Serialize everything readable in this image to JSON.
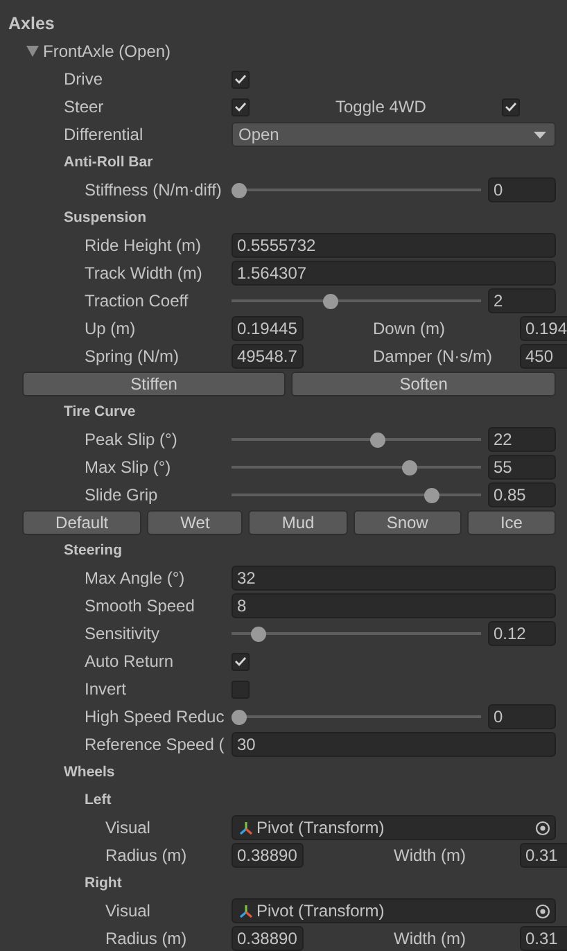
{
  "title": "Axles",
  "axles": [
    {
      "label": "FrontAxle  (Open)",
      "expanded": true,
      "children": [
        {
          "kind": "toggle",
          "label": "Drive",
          "checked": true
        },
        {
          "kind": "toggle-pair",
          "label": "Steer",
          "checked": true,
          "second": {
            "label": "Toggle 4WD",
            "checked": true
          }
        },
        {
          "kind": "dropdown",
          "label": "Differential",
          "value": "Open"
        },
        {
          "kind": "section",
          "label": "Anti-Roll Bar",
          "children": [
            {
              "kind": "slider",
              "label": "Stiffness (N/m·diff)",
              "level": 0,
              "value": "0"
            }
          ]
        },
        {
          "kind": "section",
          "label": "Suspension",
          "children": [
            {
              "kind": "field",
              "label": "Ride Height (m)",
              "value": "0.5555732"
            },
            {
              "kind": "field",
              "label": "Track Width (m)",
              "value": "1.564307"
            },
            {
              "kind": "slider",
              "label": "Traction Coeff",
              "level": 0.39,
              "value": "2"
            },
            {
              "kind": "field-pair",
              "label": "Up (m)",
              "value": "0.19445",
              "second": {
                "label": "Down (m)",
                "value": "0.194"
              }
            },
            {
              "kind": "field-pair",
              "label": "Spring (N/m)",
              "value": "49548.7",
              "second": {
                "label": "Damper (N·s/m)",
                "value": "450"
              }
            },
            {
              "kind": "buttons",
              "buttons": [
                "Stiffen",
                "Soften"
              ]
            }
          ]
        },
        {
          "kind": "section",
          "label": "Tire Curve",
          "children": [
            {
              "kind": "slider",
              "label": "Peak Slip (°)",
              "level": 0.59,
              "value": "22"
            },
            {
              "kind": "slider",
              "label": "Max Slip (°)",
              "level": 0.73,
              "value": "55"
            },
            {
              "kind": "slider",
              "label": "Slide Grip",
              "level": 0.82,
              "value": "0.85"
            },
            {
              "kind": "buttons",
              "buttons": [
                "Default",
                "Wet",
                "Mud",
                "Snow",
                "Ice"
              ]
            }
          ]
        },
        {
          "kind": "section",
          "label": "Steering",
          "children": [
            {
              "kind": "field",
              "label": "Max Angle (°)",
              "value": "32"
            },
            {
              "kind": "field",
              "label": "Smooth Speed",
              "value": "8"
            },
            {
              "kind": "slider",
              "label": "Sensitivity",
              "level": 0.08,
              "value": "0.12"
            },
            {
              "kind": "toggle",
              "label": "Auto Return",
              "checked": true
            },
            {
              "kind": "toggle",
              "label": "Invert",
              "checked": false
            },
            {
              "kind": "slider",
              "label": "High Speed Reduc",
              "level": 0,
              "value": "0"
            },
            {
              "kind": "field",
              "label": "Reference Speed (",
              "value": "30"
            }
          ]
        },
        {
          "kind": "section",
          "label": "Wheels",
          "children": [
            {
              "kind": "section",
              "label": "Left",
              "children": [
                {
                  "kind": "object",
                  "label": "Visual",
                  "value": "Pivot (Transform)"
                },
                {
                  "kind": "field-pair",
                  "label": "Radius (m)",
                  "value": "0.38890",
                  "second": {
                    "label": "Width (m)",
                    "value": "0.31"
                  }
                }
              ]
            },
            {
              "kind": "section",
              "label": "Right",
              "children": [
                {
                  "kind": "object",
                  "label": "Visual",
                  "value": "Pivot (Transform)"
                },
                {
                  "kind": "field-pair",
                  "label": "Radius (m)",
                  "value": "0.38890",
                  "second": {
                    "label": "Width (m)",
                    "value": "0.31"
                  }
                }
              ]
            }
          ]
        }
      ]
    }
  ]
}
